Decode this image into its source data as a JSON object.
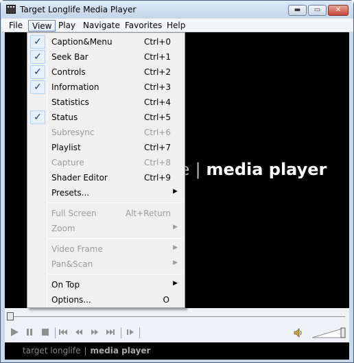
{
  "window": {
    "title": "Target Longlife Media Player"
  },
  "titlebar_buttons": {
    "minimize": "▬",
    "maximize": "▭",
    "close": "✕"
  },
  "menubar": [
    "File",
    "View",
    "Play",
    "Navigate",
    "Favorites",
    "Help"
  ],
  "active_menu": "View",
  "view_menu": {
    "items": [
      {
        "label": "Caption&Menu",
        "shortcut": "Ctrl+0",
        "checked": true,
        "disabled": false,
        "submenu": false
      },
      {
        "label": "Seek Bar",
        "shortcut": "Ctrl+1",
        "checked": true,
        "disabled": false,
        "submenu": false
      },
      {
        "label": "Controls",
        "shortcut": "Ctrl+2",
        "checked": true,
        "disabled": false,
        "submenu": false
      },
      {
        "label": "Information",
        "shortcut": "Ctrl+3",
        "checked": true,
        "disabled": false,
        "submenu": false
      },
      {
        "label": "Statistics",
        "shortcut": "Ctrl+4",
        "checked": false,
        "disabled": false,
        "submenu": false
      },
      {
        "label": "Status",
        "shortcut": "Ctrl+5",
        "checked": true,
        "disabled": false,
        "submenu": false
      },
      {
        "label": "Subresync",
        "shortcut": "Ctrl+6",
        "checked": false,
        "disabled": true,
        "submenu": false
      },
      {
        "label": "Playlist",
        "shortcut": "Ctrl+7",
        "checked": false,
        "disabled": false,
        "submenu": false
      },
      {
        "label": "Capture",
        "shortcut": "Ctrl+8",
        "checked": false,
        "disabled": true,
        "submenu": false
      },
      {
        "label": "Shader Editor",
        "shortcut": "Ctrl+9",
        "checked": false,
        "disabled": false,
        "submenu": false
      },
      {
        "label": "Presets...",
        "shortcut": "",
        "checked": false,
        "disabled": false,
        "submenu": true
      },
      {
        "label": "Full Screen",
        "shortcut": "Alt+Return",
        "checked": false,
        "disabled": true,
        "submenu": false
      },
      {
        "label": "Zoom",
        "shortcut": "",
        "checked": false,
        "disabled": true,
        "submenu": true
      },
      {
        "label": "Video Frame",
        "shortcut": "",
        "checked": false,
        "disabled": true,
        "submenu": true
      },
      {
        "label": "Pan&Scan",
        "shortcut": "",
        "checked": false,
        "disabled": true,
        "submenu": true
      },
      {
        "label": "On Top",
        "shortcut": "",
        "checked": false,
        "disabled": false,
        "submenu": true
      },
      {
        "label": "Options...",
        "shortcut": "O",
        "checked": false,
        "disabled": false,
        "submenu": false
      }
    ]
  },
  "video": {
    "brand_light": "le",
    "brand_separator": "|",
    "brand_bold": "media player"
  },
  "controls": {
    "icons": [
      "play-icon",
      "pause-icon",
      "stop-icon",
      "skip-back-icon",
      "rewind-icon",
      "fast-forward-icon",
      "skip-forward-icon",
      "frame-step-icon",
      "volume-icon"
    ],
    "volume_level": 1.0
  },
  "status": {
    "brand_light": "target longlife",
    "separator": "|",
    "brand_bold": "media player"
  },
  "colors": {
    "video_bg": "#000000",
    "menu_bg": "#f0f0f0",
    "check_highlight": "#e6f0fa",
    "disabled_text": "#9a9a9a"
  }
}
